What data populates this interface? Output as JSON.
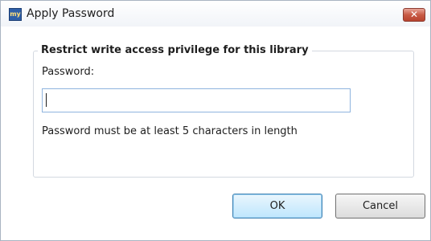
{
  "window": {
    "title": "Apply Password",
    "app_icon_text": "my",
    "close_glyph": "✕"
  },
  "group": {
    "legend": "Restrict write access privilege for this library",
    "password_label": "Password:",
    "password_value": "",
    "hint": "Password must be at least 5 characters in length"
  },
  "buttons": {
    "ok": "OK",
    "cancel": "Cancel"
  },
  "icons": {
    "app": "app-icon",
    "close": "close-icon"
  },
  "colors": {
    "close_button": "#c85a45",
    "input_border": "#8fb4de",
    "default_button_border": "#3c7fb1"
  }
}
